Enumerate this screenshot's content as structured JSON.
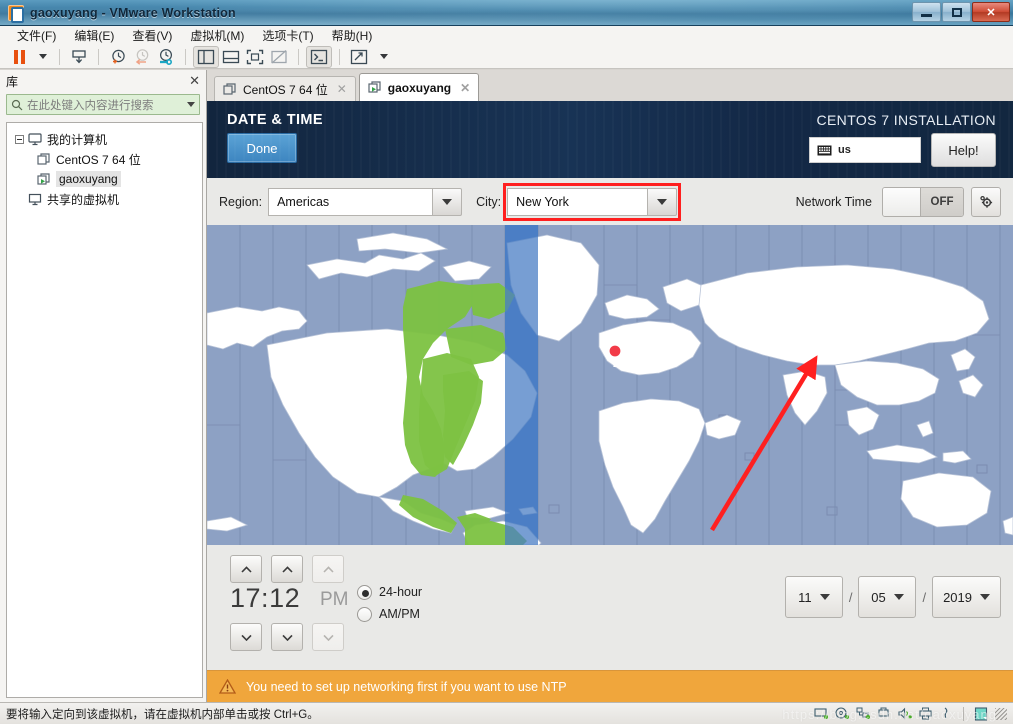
{
  "window": {
    "title": "gaoxuyang - VMware Workstation",
    "logo_icon": "vmware-logo-icon",
    "minimize_label": "Minimize",
    "maximize_label": "Maximize",
    "close_label": "Close"
  },
  "menubar": {
    "items": [
      {
        "label": "文件(F)",
        "name": "menu-file"
      },
      {
        "label": "编辑(E)",
        "name": "menu-edit"
      },
      {
        "label": "查看(V)",
        "name": "menu-view"
      },
      {
        "label": "虚拟机(M)",
        "name": "menu-vm"
      },
      {
        "label": "选项卡(T)",
        "name": "menu-tabs"
      },
      {
        "label": "帮助(H)",
        "name": "menu-help"
      }
    ]
  },
  "toolbar": {
    "items": [
      {
        "name": "pause-vm-button",
        "icon": "pause-icon"
      },
      {
        "name": "power-dropdown-button",
        "icon": "caret-down-icon"
      },
      {
        "name": "snapshot-take-button",
        "icon": "snapshot-icon"
      },
      {
        "name": "snapshot-manager-button",
        "icon": "clock-plus-icon"
      },
      {
        "name": "revert-snapshot-button",
        "icon": "clock-back-icon"
      },
      {
        "name": "manage-snapshots-button",
        "icon": "clock-wrench-icon"
      },
      {
        "name": "show-library-button",
        "icon": "panel-left-icon"
      },
      {
        "name": "show-thumbnail-bar-button",
        "icon": "panel-bottom-icon"
      },
      {
        "name": "fullscreen-button",
        "icon": "fullscreen-icon"
      },
      {
        "name": "unity-mode-button",
        "icon": "unity-icon"
      },
      {
        "name": "console-button",
        "icon": "terminal-icon"
      },
      {
        "name": "stretch-guest-button",
        "icon": "stretch-icon"
      },
      {
        "name": "stretch-dropdown-button",
        "icon": "caret-down-icon"
      }
    ]
  },
  "sidebar": {
    "title": "库",
    "close_icon": "close-icon",
    "search": {
      "placeholder": "在此处键入内容进行搜索",
      "value": "",
      "icon": "search-icon",
      "dropdown_icon": "caret-down-icon"
    },
    "tree": [
      {
        "label": "我的计算机",
        "name": "tree-my-computer",
        "level": 0,
        "icon": "computer-icon",
        "expanded": true
      },
      {
        "label": "CentOS 7 64 位",
        "name": "tree-centos7",
        "level": 2,
        "icon": "vm-icon",
        "selected": false
      },
      {
        "label": "gaoxuyang",
        "name": "tree-gaoxuyang",
        "level": 2,
        "icon": "vm-running-icon",
        "selected": true
      },
      {
        "label": "共享的虚拟机",
        "name": "tree-shared-vms",
        "level": 1,
        "icon": "shared-vm-icon"
      }
    ]
  },
  "tabs": [
    {
      "label": "CentOS 7 64 位",
      "name": "tab-centos7",
      "active": false,
      "icon": "vm-icon",
      "close_icon": "close-icon"
    },
    {
      "label": "gaoxuyang",
      "name": "tab-gaoxuyang",
      "active": true,
      "icon": "vm-running-icon",
      "close_icon": "close-icon"
    }
  ],
  "installer": {
    "screen_title": "DATE & TIME",
    "done_label": "Done",
    "product_title": "CENTOS 7 INSTALLATION",
    "keyboard_layout": "us",
    "keyboard_icon": "keyboard-icon",
    "help_label": "Help!",
    "region_label": "Region:",
    "region_value": "Americas",
    "city_label": "City:",
    "city_value": "New York",
    "network_time_label": "Network Time",
    "network_time_state": "OFF",
    "network_time_settings_icon": "gear-icon",
    "dropdown_icon": "caret-down-icon",
    "highlight_color": "#ff1f1f",
    "time": {
      "hours": "17",
      "separator": ":",
      "minutes": "12",
      "ampm": "PM",
      "up_icon": "chevron-up-icon",
      "down_icon": "chevron-down-icon",
      "format_options": [
        {
          "label": "24-hour",
          "name": "radio-24-hour",
          "selected": true
        },
        {
          "label": "AM/PM",
          "name": "radio-am-pm",
          "selected": false
        }
      ]
    },
    "date": {
      "month": "11",
      "day": "05",
      "year": "2019",
      "separator": "/"
    },
    "warning": {
      "icon": "warning-icon",
      "text": "You need to set up networking first if you want to use NTP"
    },
    "map": {
      "selected_marker": "new-york-pin",
      "annotation_icon": "red-arrow-icon",
      "ocean_color": "#8da1c4",
      "land_color": "#ffffff",
      "highlight_zone_color": "#7dc242",
      "selected_zone_color": "#4a7ec4",
      "marker_color": "#f23b48"
    }
  },
  "statusbar": {
    "message": "要将输入定向到该虚拟机，请在虚拟机内部单击或按 Ctrl+G。",
    "icons": [
      {
        "name": "status-harddisk-icon"
      },
      {
        "name": "status-cdrom-icon"
      },
      {
        "name": "status-network-icon"
      },
      {
        "name": "status-usb-icon"
      },
      {
        "name": "status-sound-icon"
      },
      {
        "name": "status-printer-icon"
      },
      {
        "name": "status-display-icon"
      },
      {
        "name": "status-message-icon"
      }
    ],
    "watermark": "https://blog.csdn.net/gaoxuyang"
  }
}
